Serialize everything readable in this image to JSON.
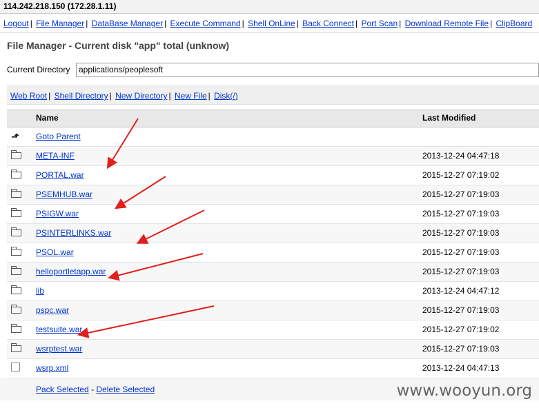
{
  "host": "114.242.218.150 (172.28.1.11)",
  "menu": [
    "Logout",
    "File Manager",
    "DataBase Manager",
    "Execute Command",
    "Shell OnLine",
    "Back Connect",
    "Port Scan",
    "Download Remote File",
    "ClipBoard"
  ],
  "file_manager": {
    "title": "File Manager - Current disk \"app\" total (unknow)",
    "current_dir_label": "Current Directory",
    "current_dir_value": "applications/peoplesoft"
  },
  "quick_links": [
    "Web Root",
    "Shell Directory",
    "New Directory",
    "New File",
    "Disk(/)"
  ],
  "table": {
    "headers": {
      "name": "Name",
      "modified": "Last Modified"
    },
    "parent": "Goto Parent",
    "rows": [
      {
        "name": "META-INF",
        "modified": "2013-12-24 04:47:18",
        "type": "folder"
      },
      {
        "name": "PORTAL.war",
        "modified": "2015-12-27 07:19:02",
        "type": "folder"
      },
      {
        "name": "PSEMHUB.war",
        "modified": "2015-12-27 07:19:03",
        "type": "folder"
      },
      {
        "name": "PSIGW.war",
        "modified": "2015-12-27 07:19:03",
        "type": "folder"
      },
      {
        "name": "PSINTERLINKS.war",
        "modified": "2015-12-27 07:19:03",
        "type": "folder"
      },
      {
        "name": "PSOL.war",
        "modified": "2015-12-27 07:19:03",
        "type": "folder"
      },
      {
        "name": "helloportletapp.war",
        "modified": "2015-12-27 07:19:03",
        "type": "folder"
      },
      {
        "name": "lib",
        "modified": "2013-12-24 04:47:12",
        "type": "folder"
      },
      {
        "name": "pspc.war",
        "modified": "2015-12-27 07:19:03",
        "type": "folder"
      },
      {
        "name": "testsuite.war",
        "modified": "2015-12-27 07:19:02",
        "type": "folder"
      },
      {
        "name": "wsrptest.war",
        "modified": "2015-12-27 07:19:03",
        "type": "folder"
      },
      {
        "name": "wsrp.xml",
        "modified": "2013-12-24 04:47:13",
        "type": "file"
      }
    ]
  },
  "actions": {
    "pack": "Pack Selected",
    "delete": "Delete Selected"
  },
  "watermark": "www.wooyun.org",
  "colors": {
    "link": "#0033cc",
    "annotation_arrow": "#e0201b"
  }
}
